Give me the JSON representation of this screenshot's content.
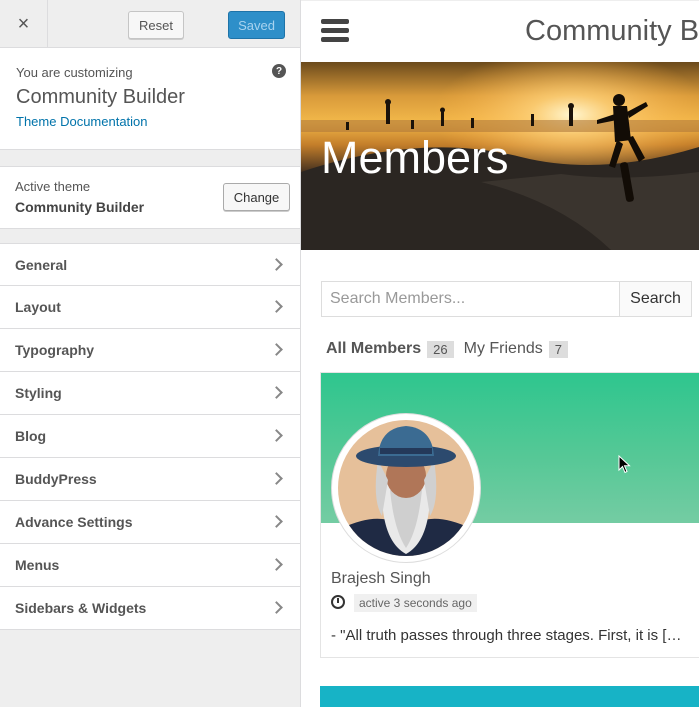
{
  "customizer": {
    "close_label": "×",
    "reset_label": "Reset",
    "saved_label": "Saved",
    "info": {
      "pre": "You are customizing",
      "title": "Community Builder",
      "link": "Theme Documentation",
      "help_glyph": "?"
    },
    "theme": {
      "pre": "Active theme",
      "name": "Community Builder",
      "change_label": "Change"
    },
    "sections": [
      {
        "label": "General"
      },
      {
        "label": "Layout"
      },
      {
        "label": "Typography"
      },
      {
        "label": "Styling"
      },
      {
        "label": "Blog"
      },
      {
        "label": "BuddyPress"
      },
      {
        "label": "Advance Settings"
      },
      {
        "label": "Menus"
      },
      {
        "label": "Sidebars & Widgets"
      }
    ]
  },
  "preview": {
    "site_title": "Community Bu",
    "hero_title": "Members",
    "search": {
      "placeholder": "Search Members...",
      "button": "Search"
    },
    "tabs": [
      {
        "label": "All Members",
        "count": "26"
      },
      {
        "label": "My Friends",
        "count": "7"
      }
    ],
    "member": {
      "name": "Brajesh Singh",
      "activity": "active 3 seconds ago",
      "quote": "- \"All truth passes through three stages. First, it is […"
    }
  },
  "colors": {
    "accent": "#2e8fc9",
    "link": "#0073aa",
    "card_cover": "#2ec68e",
    "next_card": "#17b3c6"
  }
}
